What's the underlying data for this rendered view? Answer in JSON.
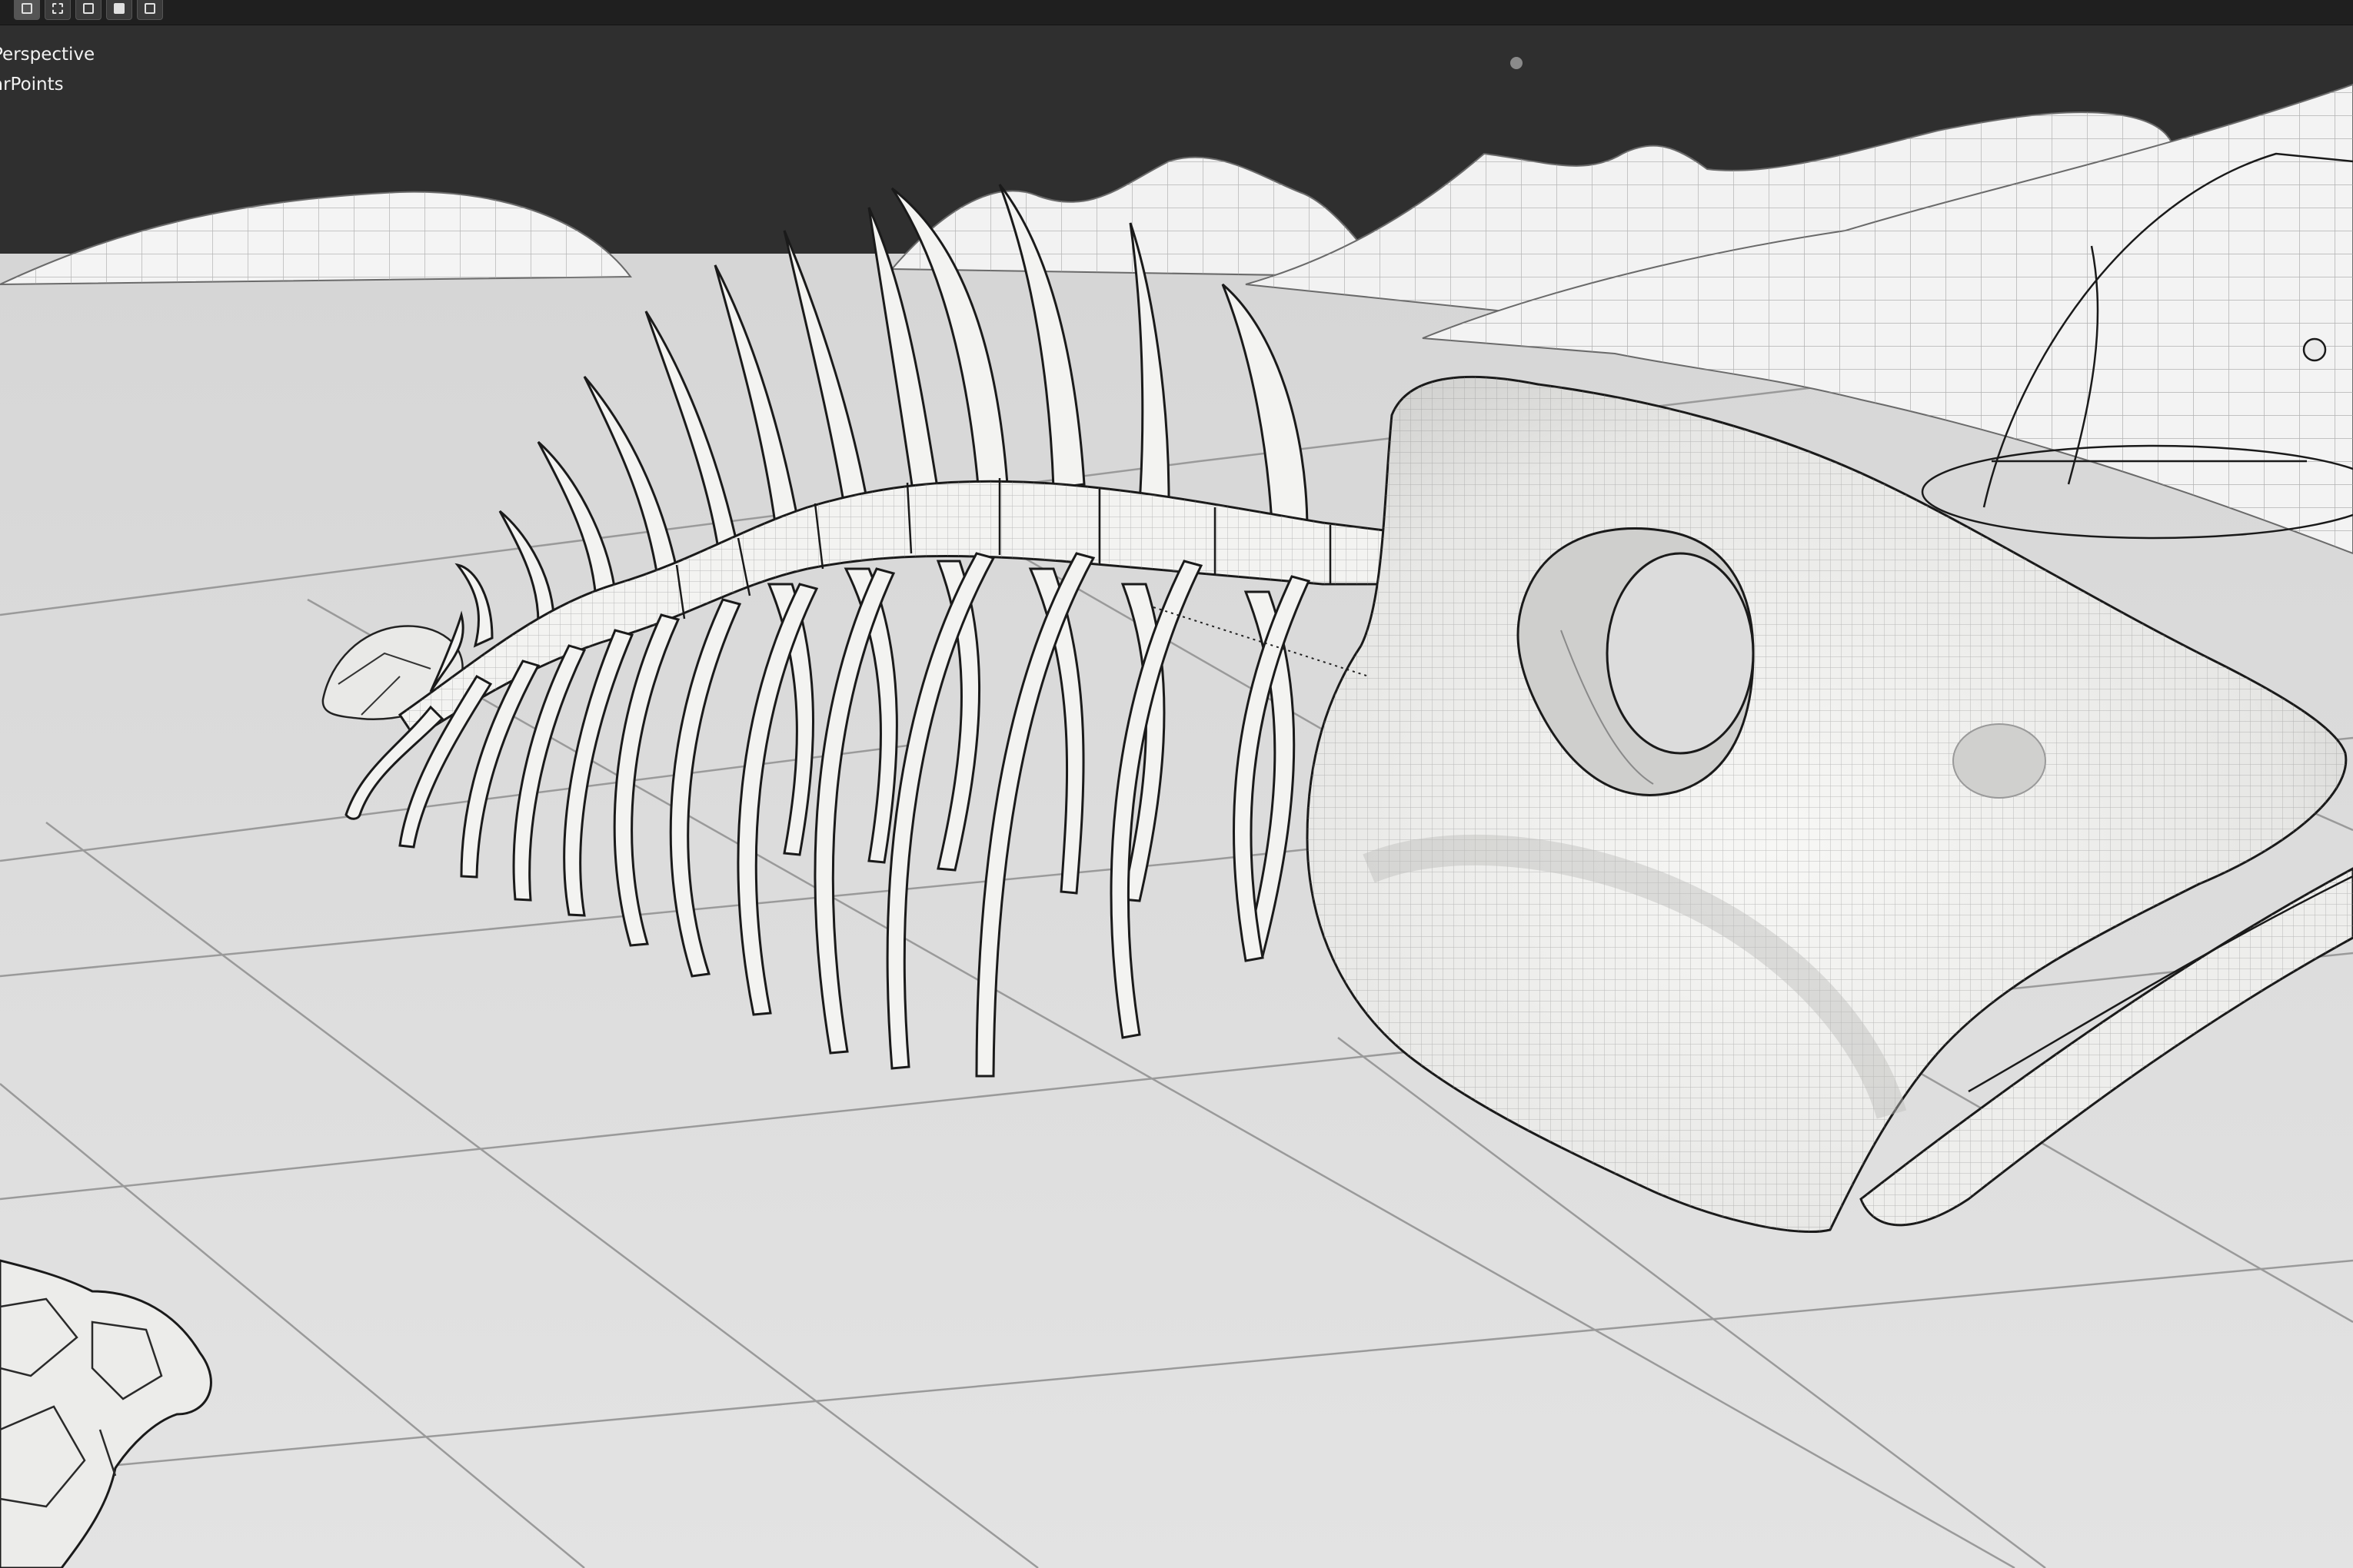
{
  "viewport": {
    "view_label": "Perspective",
    "object_label": "arPoints",
    "header_modes": [
      "select-box-icon",
      "select-extend-icon",
      "select-subtract-icon",
      "select-invert-icon",
      "select-intersect-icon"
    ]
  },
  "colors": {
    "background": "#2f2f2f",
    "ground": "#dcdcdc",
    "mesh_fill": "#f3f3f1",
    "wire": "#1a1a1a"
  }
}
